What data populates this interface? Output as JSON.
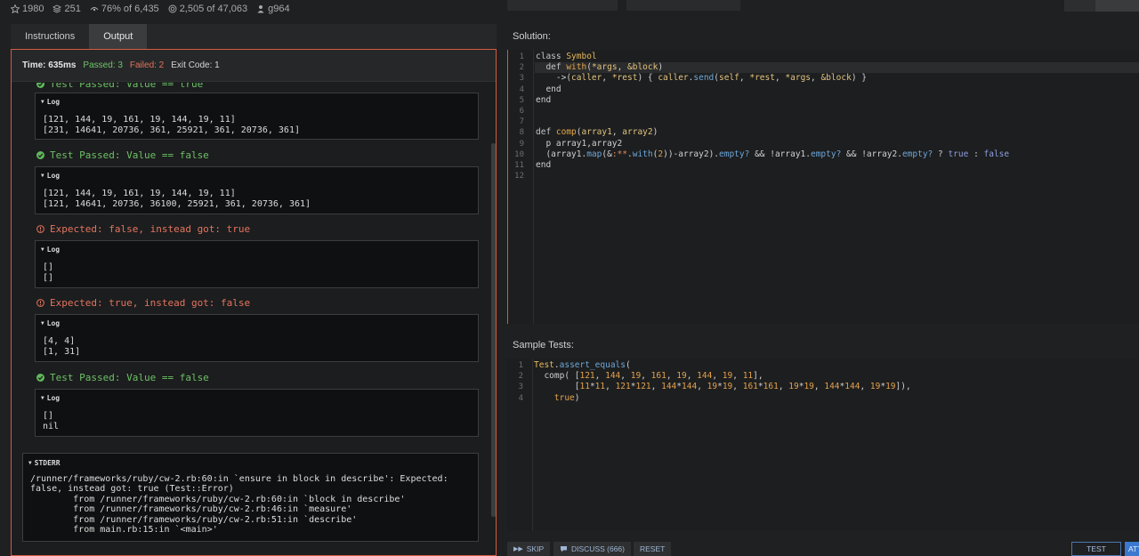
{
  "stats": [
    {
      "icon": "star-icon",
      "value": "1980"
    },
    {
      "icon": "stack-icon",
      "value": "251"
    },
    {
      "icon": "thumbs-icon",
      "value": "76% of 6,435"
    },
    {
      "icon": "target-icon",
      "value": "2,505 of 47,063"
    },
    {
      "icon": "user-icon",
      "value": "g964"
    }
  ],
  "tabs": [
    "Instructions",
    "Output"
  ],
  "status": {
    "time": "Time: 635ms",
    "passed": "Passed: 3",
    "failed": "Failed: 2",
    "exit": "Exit Code: 1"
  },
  "output": {
    "partial_top": "Test Passed: Value == true",
    "log_label": "Log",
    "log1": [
      "[121, 144, 19, 161, 19, 144, 19, 11]",
      "[231, 14641, 20736, 361, 25921, 361, 20736, 361]"
    ],
    "result2": "Test Passed: Value == false",
    "log2": [
      "[121, 144, 19, 161, 19, 144, 19, 11]",
      "[121, 14641, 20736, 36100, 25921, 361, 20736, 361]"
    ],
    "result3": "Expected: false, instead got: true",
    "log3": [
      "[]",
      "[]"
    ],
    "result4": "Expected: true, instead got: false",
    "log4": [
      "[4, 4]",
      "[1, 31]"
    ],
    "result5": "Test Passed: Value == false",
    "log5": [
      "[]",
      "nil"
    ],
    "stderr_label": "STDERR",
    "stderr": [
      "/runner/frameworks/ruby/cw-2.rb:60:in `ensure in block in describe': Expected:",
      "false, instead got: true (Test::Error)",
      "        from /runner/frameworks/ruby/cw-2.rb:60:in `block in describe'",
      "        from /runner/frameworks/ruby/cw-2.rb:46:in `measure'",
      "        from /runner/frameworks/ruby/cw-2.rb:51:in `describe'",
      "        from main.rb:15:in `<main>'"
    ]
  },
  "solution_label": "Solution:",
  "sample_label": "Sample Tests:",
  "solution_code": [
    "class Symbol",
    "  def with(*args, &block)",
    "    ->(caller, *rest) { caller.send(self, *rest, *args, &block) }",
    "  end",
    "end",
    "",
    "",
    "def comp(array1, array2)",
    "  p array1,array2",
    "  (array1.map(&:**.with(2))-array2).empty? && !array1.empty? && !array2.empty? ? true : false",
    "end",
    ""
  ],
  "sample_code": [
    "Test.assert_equals(",
    "  comp( [121, 144, 19, 161, 19, 144, 19, 11],",
    "        [11*11, 121*121, 144*144, 19*19, 161*161, 19*19, 144*144, 19*19]),",
    "    true)"
  ],
  "buttons": {
    "skip": "SKIP",
    "discuss": "DISCUSS (666)",
    "reset": "RESET",
    "test": "TEST",
    "attempt": "ATTEMPT"
  }
}
